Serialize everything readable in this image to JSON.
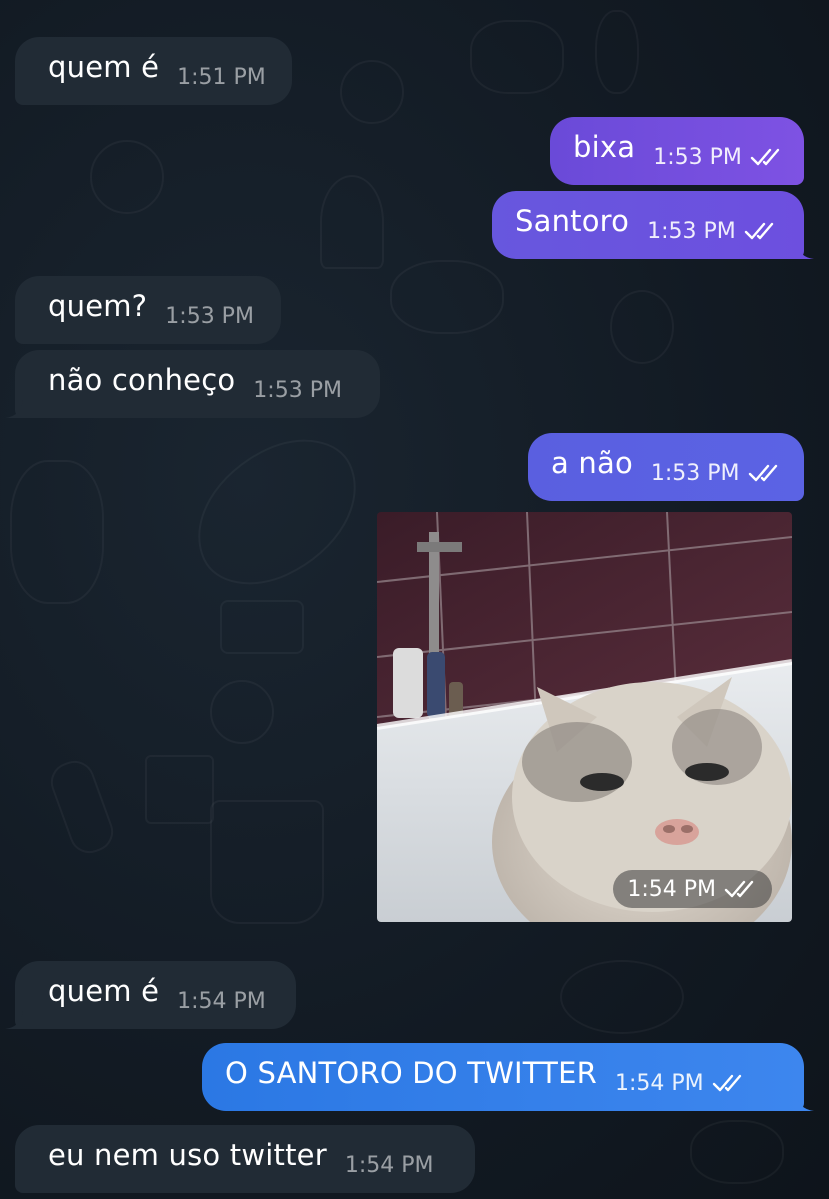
{
  "chat": {
    "messages": [
      {
        "direction": "incoming",
        "text": "quem é",
        "time": "1:51 PM"
      },
      {
        "direction": "outgoing",
        "text": "bixa",
        "time": "1:53 PM",
        "read": true
      },
      {
        "direction": "outgoing",
        "text": "Santoro",
        "time": "1:53 PM",
        "read": true
      },
      {
        "direction": "incoming",
        "text": "quem?",
        "time": "1:53 PM"
      },
      {
        "direction": "incoming",
        "text": "não conheço",
        "time": "1:53 PM"
      },
      {
        "direction": "outgoing",
        "text": "a não",
        "time": "1:53 PM",
        "read": true
      },
      {
        "direction": "outgoing",
        "type": "photo",
        "image": "cat-in-bathtub-photo",
        "time": "1:54 PM",
        "read": true
      },
      {
        "direction": "incoming",
        "text": "quem é",
        "time": "1:54 PM"
      },
      {
        "direction": "outgoing",
        "text": "O SANTORO DO TWITTER",
        "time": "1:54 PM",
        "read": true
      },
      {
        "direction": "incoming",
        "text": "eu nem uso twitter",
        "time": "1:54 PM"
      }
    ]
  },
  "colors": {
    "background": "#121a23",
    "incoming_bubble": "#212b35",
    "outgoing_purple": "#7e52e3",
    "outgoing_blue": "#3d86ee",
    "read_check": "#ffffff"
  },
  "icons": {
    "read_receipt": "double-check-icon"
  }
}
